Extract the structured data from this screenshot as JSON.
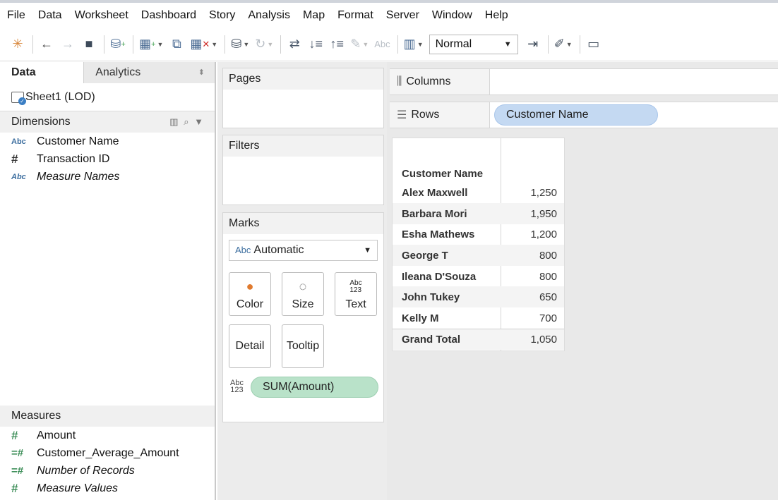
{
  "menu": [
    "File",
    "Data",
    "Worksheet",
    "Dashboard",
    "Story",
    "Analysis",
    "Map",
    "Format",
    "Server",
    "Window",
    "Help"
  ],
  "toolbar": {
    "icons": [
      "tableau-logo-icon",
      "back-arrow-icon",
      "forward-arrow-icon",
      "save-icon",
      "new-data-source-icon",
      "new-worksheet-icon",
      "duplicate-icon",
      "clear-sheet-icon",
      "pause-updates-icon",
      "refresh-icon",
      "swap-icon",
      "sort-ascending-icon",
      "sort-descending-icon",
      "highlight-icon",
      "labels-icon",
      "show-me-icon",
      "fix-axes-icon",
      "annotate-icon",
      "presentation-icon"
    ],
    "labels_text": "Abc",
    "view_size": "Normal"
  },
  "left_pane": {
    "tabs": {
      "data": "Data",
      "analytics": "Analytics"
    },
    "datasource": "Sheet1 (LOD)",
    "dimensions_header": "Dimensions",
    "dimensions": [
      {
        "type": "Abc",
        "name": "Customer Name"
      },
      {
        "type": "#",
        "name": "Transaction ID"
      },
      {
        "type": "Abc",
        "name": "Measure Names"
      }
    ],
    "measures_header": "Measures",
    "measures": [
      {
        "type": "#",
        "name": "Amount"
      },
      {
        "type": "=#",
        "name": "Customer_Average_Amount"
      },
      {
        "type": "=#",
        "name": "Number of Records"
      },
      {
        "type": "#",
        "name": "Measure Values"
      }
    ]
  },
  "shelves": {
    "pages": "Pages",
    "filters": "Filters",
    "marks": {
      "header": "Marks",
      "mark_type_icon": "Abc",
      "mark_type": "Automatic",
      "buttons": {
        "color": "Color",
        "size": "Size",
        "text": "Text",
        "detail": "Detail",
        "tooltip": "Tooltip"
      },
      "text_icon": "Abc 123",
      "pill": "SUM(Amount)"
    },
    "columns": "Columns",
    "rows": "Rows",
    "rows_pill": "Customer Name"
  },
  "crosstab": {
    "header": "Customer Name",
    "rows": [
      {
        "name": "Alex Maxwell",
        "value": "1,250"
      },
      {
        "name": "Barbara Mori",
        "value": "1,950"
      },
      {
        "name": "Esha Mathews",
        "value": "1,200"
      },
      {
        "name": "George T",
        "value": "800"
      },
      {
        "name": "Ileana D'Souza",
        "value": "800"
      },
      {
        "name": "John Tukey",
        "value": "650"
      },
      {
        "name": "Kelly M",
        "value": "700"
      }
    ],
    "total": {
      "name": "Grand Total",
      "value": "1,050"
    }
  }
}
